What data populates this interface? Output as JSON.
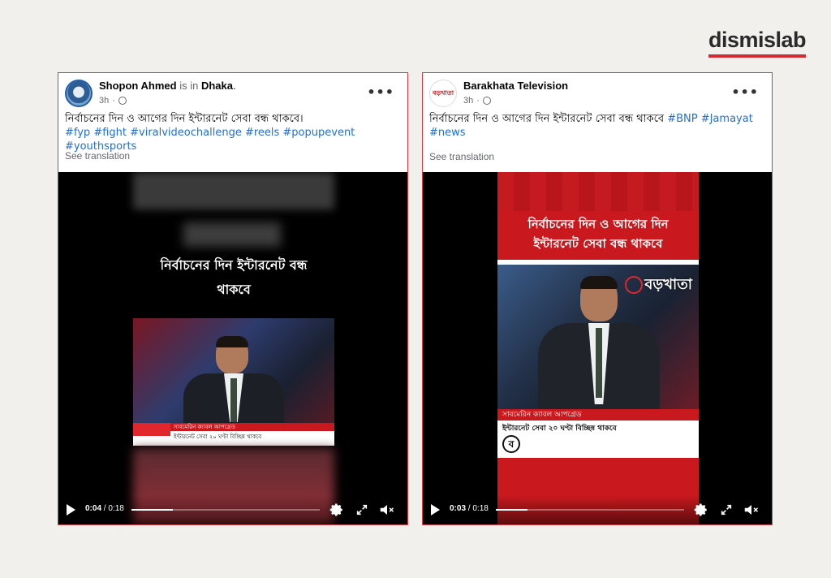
{
  "brand": {
    "logo_text": "dismislab",
    "accent": "#d42a31"
  },
  "posts": [
    {
      "author": "Shopon Ahmed",
      "is_in": "is in",
      "location": "Dhaka",
      "location_suffix": ".",
      "time": "3h",
      "text": "নির্বাচনের দিন ও আগের দিন ইন্টারনেট সেবা বন্ধ থাকবে।",
      "hashtags": "#fyp #fight #viralvideochallenge #reels #popupevent #youthsports",
      "see_translation": "See translation",
      "video": {
        "caption_line1": "নির্বাচনের দিন ইন্টারনেট বন্ধ",
        "caption_line2": "থাকবে",
        "lower_third_top": "সাবমেরিন ক্যাবল আপগ্রেড",
        "lower_third_bottom": "ইন্টারনেট সেবা ২০ ঘণ্টা বিচ্ছিন্ন থাকবে",
        "current_time": "0:04",
        "duration": "0:18",
        "progress": 0.22
      }
    },
    {
      "author": "Barakhata Television",
      "time": "3h",
      "text": "নির্বাচনের দিন ও আগের দিন ইন্টারনেট সেবা বন্ধ থাকবে",
      "hashtags_inline": "#BNP #Jamayat",
      "hashtags_line2": "#news",
      "see_translation": "See translation",
      "video": {
        "headline_line1": "নির্বাচনের দিন ও আগের দিন",
        "headline_line2": "ইন্টারনেট সেবা বন্ধ থাকবে",
        "channel_logo": "বড়খাতা",
        "lower_third_top": "সাবমেরিন ক্যাবল আপগ্রেড",
        "lower_third_bottom": "ইন্টারনেট সেবা ২০ ঘণ্টা বিচ্ছিন্ন থাকবে",
        "badge": "ব",
        "current_time": "0:03",
        "duration": "0:18",
        "progress": 0.17
      }
    }
  ]
}
